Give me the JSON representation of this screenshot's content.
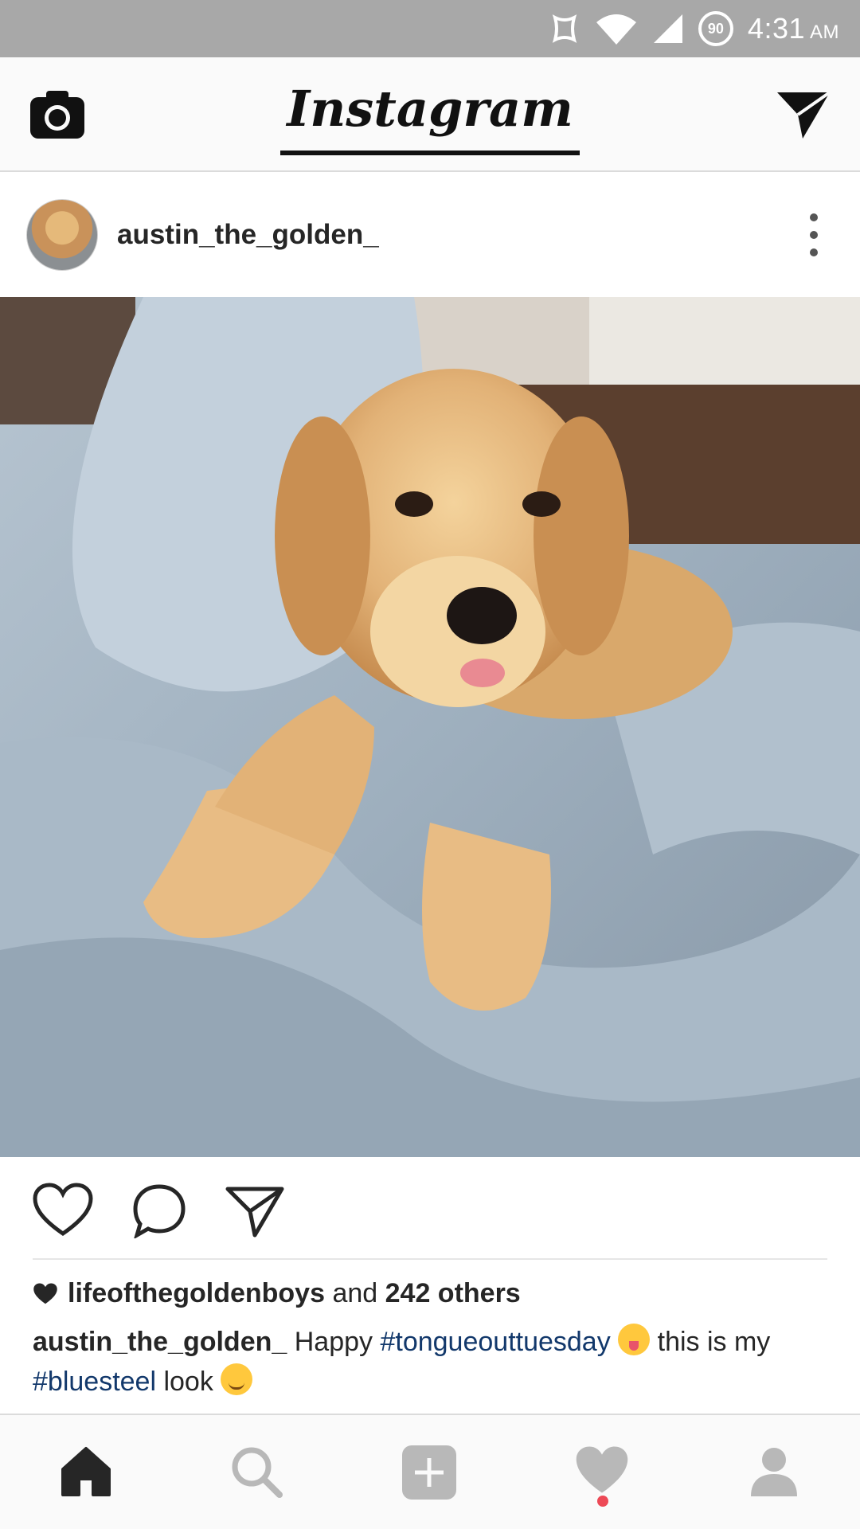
{
  "status_bar": {
    "battery_level": "90",
    "time": "4:31",
    "ampm": "AM"
  },
  "header": {
    "app_name": "Instagram"
  },
  "post": {
    "username": "austin_the_golden_",
    "likes": {
      "liker": "lifeofthegoldenboys",
      "connector": " and ",
      "others": "242 others"
    },
    "caption": {
      "username": "austin_the_golden_",
      "text_1": " Happy ",
      "hashtag_1": "#tongueouttuesday",
      "text_2": " this is my ",
      "hashtag_2": "#bluesteel",
      "text_3": " look "
    }
  },
  "icons": {
    "status": [
      "nfc-icon",
      "wifi-icon",
      "signal-icon",
      "battery-icon"
    ],
    "header": [
      "camera-icon",
      "direct-message-icon"
    ],
    "actions": [
      "heart-icon",
      "comment-icon",
      "share-icon"
    ],
    "nav": [
      "home-icon",
      "search-icon",
      "add-icon",
      "activity-icon",
      "profile-icon"
    ]
  },
  "colors": {
    "status_bar": "#a8a8a8",
    "hashtag": "#12386b",
    "notification_dot": "#ed4956",
    "text": "#262626"
  }
}
